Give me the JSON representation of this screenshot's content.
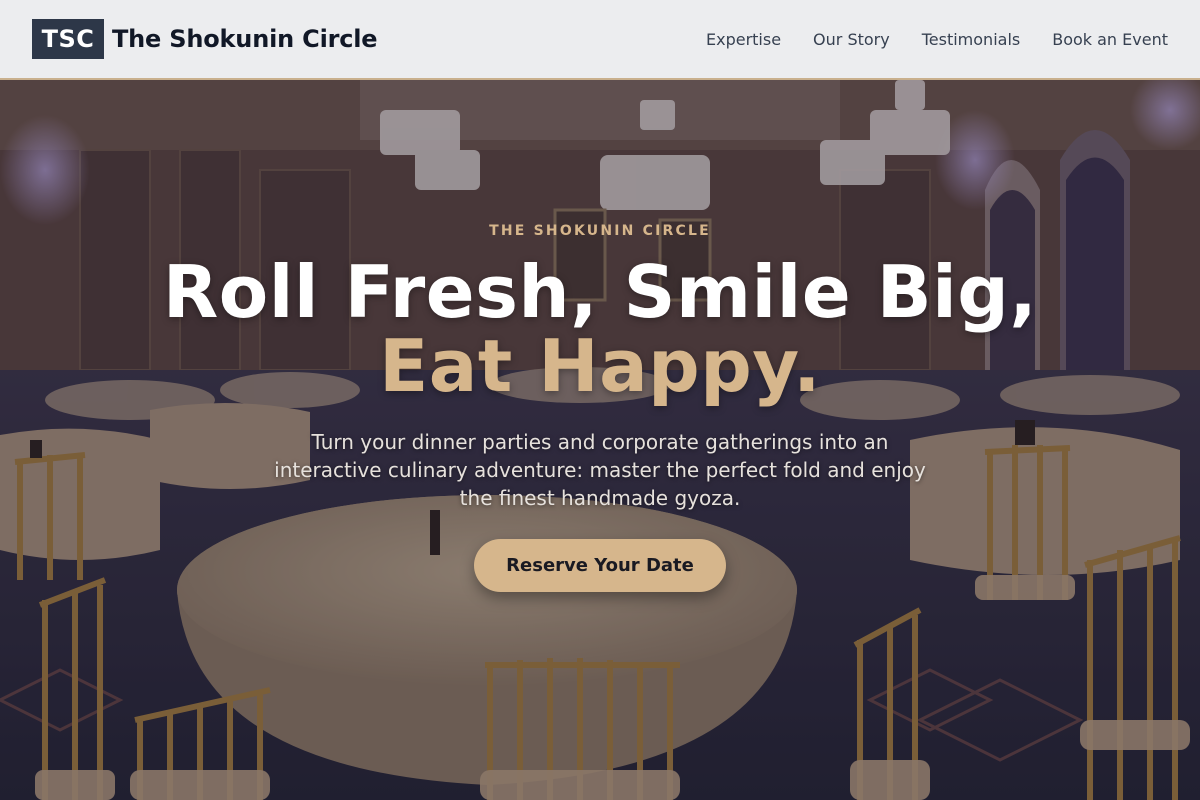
{
  "header": {
    "logo_text": "TSC",
    "brand_name": "The Shokunin Circle",
    "nav": [
      {
        "label": "Expertise"
      },
      {
        "label": "Our Story"
      },
      {
        "label": "Testimonials"
      },
      {
        "label": "Book an Event"
      }
    ]
  },
  "hero": {
    "background": "banquet-hall-photo",
    "eyebrow": "THE SHOKUNIN CIRCLE",
    "headline_line1": "Roll Fresh, Smile Big,",
    "headline_line2": "Eat Happy.",
    "subtext": "Turn your dinner parties and corporate gatherings into an interactive culinary adventure: master the perfect fold and enjoy the finest handmade gyoza.",
    "cta_label": "Reserve Your Date"
  },
  "colors": {
    "accent": "#d6b68c",
    "logo_bg": "#2d3748",
    "header_bg": "#f3f4f6",
    "text_dark": "#111827"
  }
}
